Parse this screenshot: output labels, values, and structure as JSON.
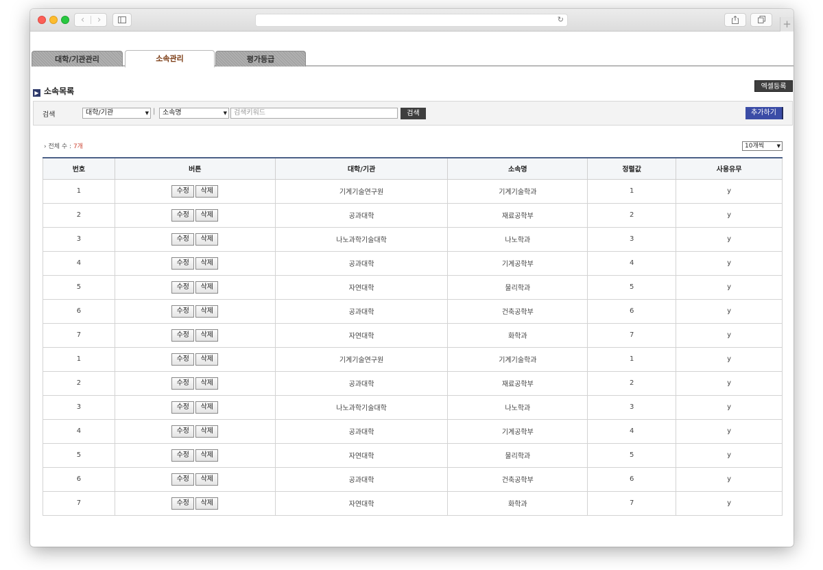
{
  "browser": {
    "back_glyph": "‹",
    "forward_glyph": "›",
    "reload_glyph": "↻",
    "newtab_glyph": "+"
  },
  "tabs": [
    {
      "label": "대학/기관관리",
      "active": false
    },
    {
      "label": "소속관리",
      "active": true
    },
    {
      "label": "평가등급",
      "active": false
    }
  ],
  "section": {
    "title": "소속목록",
    "bullet": "▶"
  },
  "excel_button": "엑셀등록",
  "search": {
    "label": "검색",
    "univ_select": "대학/기관",
    "separator": "|",
    "field_select": "소속명",
    "keyword_placeholder": "검색키워드",
    "search_button": "검색",
    "add_button": "추가하기"
  },
  "count": {
    "prefix": "전체 수 :",
    "value": "7개"
  },
  "per_page": "10개씩",
  "table": {
    "headers": [
      "번호",
      "버튼",
      "대학/기관",
      "소속명",
      "정렬값",
      "사용유무"
    ],
    "edit_label": "수정",
    "delete_label": "삭제",
    "rows": [
      {
        "no": "1",
        "org": "기계기술연구원",
        "dept": "기계기술학과",
        "sort": "1",
        "use": "y"
      },
      {
        "no": "2",
        "org": "공과대학",
        "dept": "재료공학부",
        "sort": "2",
        "use": "y"
      },
      {
        "no": "3",
        "org": "나노과학기술대학",
        "dept": "나노학과",
        "sort": "3",
        "use": "y"
      },
      {
        "no": "4",
        "org": "공과대학",
        "dept": "기계공학부",
        "sort": "4",
        "use": "y"
      },
      {
        "no": "5",
        "org": "자연대학",
        "dept": "물리학과",
        "sort": "5",
        "use": "y"
      },
      {
        "no": "6",
        "org": "공과대학",
        "dept": "건축공학부",
        "sort": "6",
        "use": "y"
      },
      {
        "no": "7",
        "org": "자연대학",
        "dept": "화학과",
        "sort": "7",
        "use": "y"
      },
      {
        "no": "1",
        "org": "기계기술연구원",
        "dept": "기계기술학과",
        "sort": "1",
        "use": "y"
      },
      {
        "no": "2",
        "org": "공과대학",
        "dept": "재료공학부",
        "sort": "2",
        "use": "y"
      },
      {
        "no": "3",
        "org": "나노과학기술대학",
        "dept": "나노학과",
        "sort": "3",
        "use": "y"
      },
      {
        "no": "4",
        "org": "공과대학",
        "dept": "기계공학부",
        "sort": "4",
        "use": "y"
      },
      {
        "no": "5",
        "org": "자연대학",
        "dept": "물리학과",
        "sort": "5",
        "use": "y"
      },
      {
        "no": "6",
        "org": "공과대학",
        "dept": "건축공학부",
        "sort": "6",
        "use": "y"
      },
      {
        "no": "7",
        "org": "자연대학",
        "dept": "화학과",
        "sort": "7",
        "use": "y"
      }
    ]
  },
  "colors": {
    "accent": "#3b4ca6",
    "tab_active_text": "#7a3a12",
    "count_number": "#cc4433"
  }
}
